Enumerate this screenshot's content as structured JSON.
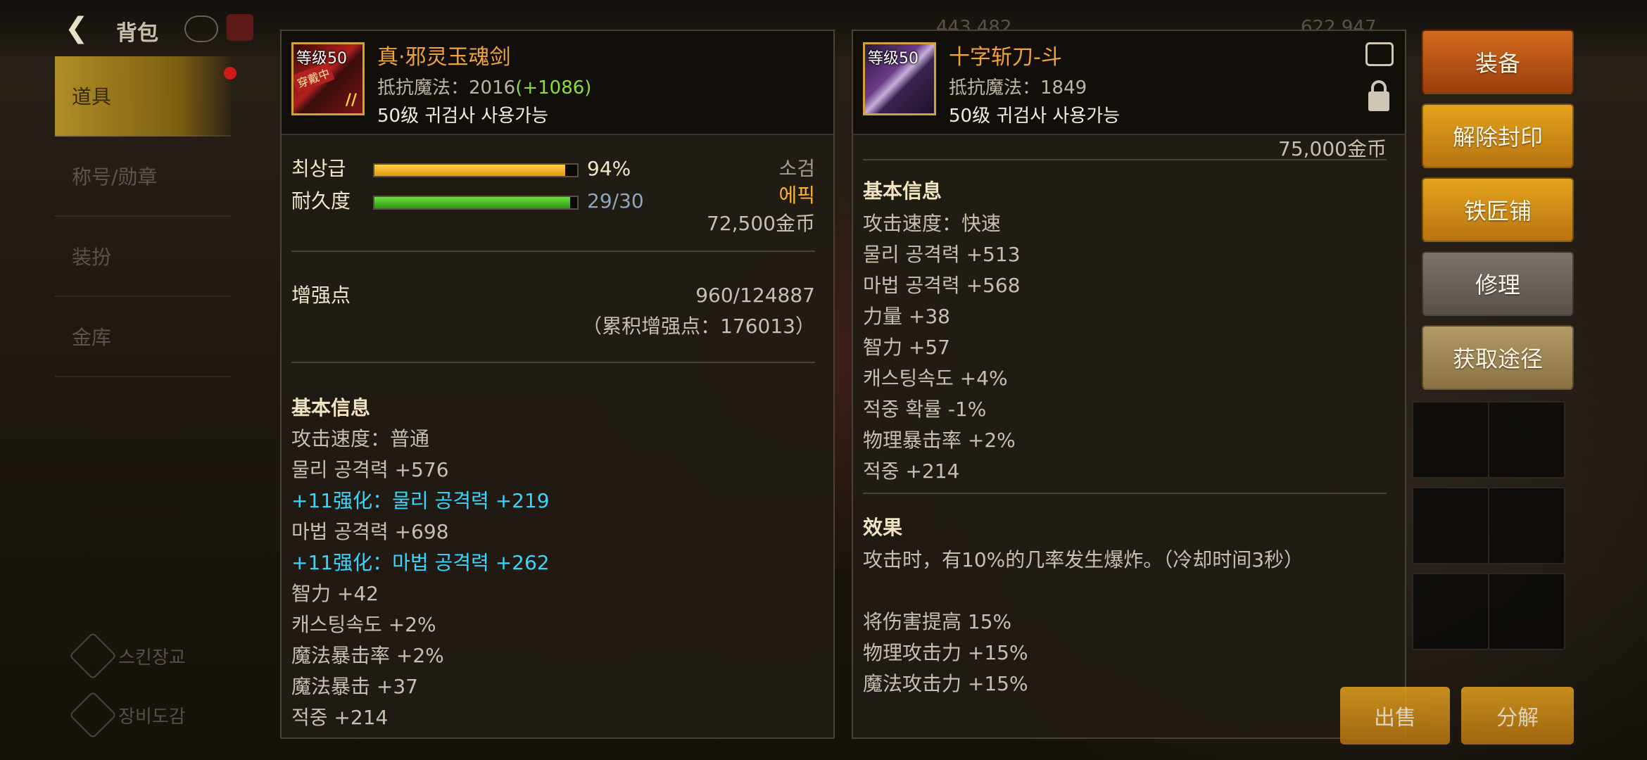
{
  "header": {
    "title": "背包",
    "stat1": "443,482",
    "stat2": "622,947"
  },
  "sidebar": {
    "items": [
      "道具",
      "称号/勋章",
      "装扮",
      "金库"
    ]
  },
  "bottom_links": [
    "스킨장교",
    "장비도감"
  ],
  "item_left": {
    "level_badge": "等级50",
    "icon_tag": "穿戴中",
    "name": "真·邪灵玉魂剑",
    "resist_label": "抵抗魔法：",
    "resist_value": "2016",
    "resist_bonus": "(+1086)",
    "class_line": "50级 귀검사 사용가능",
    "grade_label": "최상급",
    "grade_pct": 94,
    "grade_text": "94%",
    "durability_label": "耐久度",
    "durability_current": 29,
    "durability_max": 30,
    "durability_text": "29/30",
    "type": "소검",
    "rarity": "에픽",
    "price": "72,500金币",
    "enhance_label": "增强点",
    "enhance_value": "960/124887",
    "enhance_total": "（累积增强点：176013）",
    "section_basic": "基本信息",
    "stats": [
      {
        "text": "攻击速度：普通",
        "color": "gray"
      },
      {
        "text": "물리 공격력 +576",
        "color": "gray"
      },
      {
        "text": "+11强化：물리 공격력 +219",
        "color": "cyan"
      },
      {
        "text": "마법 공격력 +698",
        "color": "gray"
      },
      {
        "text": "+11强化：마법 공격력 +262",
        "color": "cyan"
      },
      {
        "text": "智力 +42",
        "color": "gray"
      },
      {
        "text": "캐스팅속도 +2%",
        "color": "gray"
      },
      {
        "text": "魔法暴击率 +2%",
        "color": "gray"
      },
      {
        "text": "魔法暴击 +37",
        "color": "gray"
      },
      {
        "text": "적중 +214",
        "color": "gray"
      }
    ]
  },
  "item_right": {
    "level_badge": "等级50",
    "name": "十字斩刀-斗",
    "resist_label": "抵抗魔法：",
    "resist_value": "1849",
    "class_line": "50级 귀검사 사용가능",
    "price": "75,000金币",
    "section_basic": "基本信息",
    "stats": [
      "攻击速度：快速",
      "물리 공격력 +513",
      "마법 공격력 +568",
      "力量 +38",
      "智力 +57",
      "캐스팅속도 +4%",
      "적중 확률 -1%",
      "物理暴击率 +2%",
      "적중 +214"
    ],
    "section_effect": "效果",
    "effects": [
      "攻击时，有10%的几率发生爆炸。（冷却时间3秒）",
      "",
      "将伤害提高 15%",
      "物理攻击力 +15%",
      "魔法攻击力 +15%"
    ]
  },
  "buttons": {
    "equip": "装备",
    "unseal": "解除封印",
    "smith": "铁匠铺",
    "repair": "修理",
    "source": "获取途径",
    "bottom_left": "出售",
    "bottom_right": "分解"
  },
  "colors": {
    "name": "#f0a23c",
    "enhance": "#36d6ff",
    "resist_bonus": "#8ddb3c",
    "grade_bar": "#f0b020",
    "durability_bar": "#3fc01a"
  }
}
